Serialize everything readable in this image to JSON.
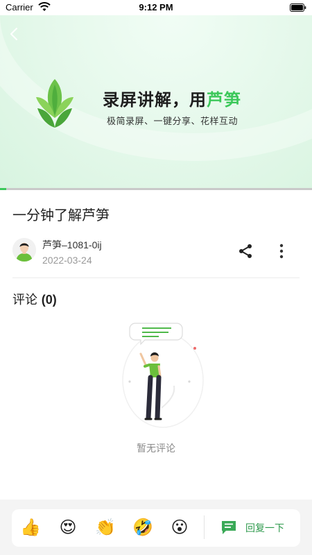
{
  "status_bar": {
    "carrier": "Carrier",
    "time": "9:12 PM"
  },
  "hero": {
    "title_main": "录屏讲解，用",
    "title_accent": "芦笋",
    "subtitle": "极简录屏、一键分享、花样互动",
    "progress_fraction": 0.02
  },
  "post": {
    "title": "一分钟了解芦笋",
    "author": "芦笋–1081-0ij",
    "date": "2022-03-24"
  },
  "comments": {
    "label": "评论",
    "count": "(0)",
    "empty_text": "暂无评论"
  },
  "reactions": [
    {
      "name": "thumbs-up",
      "glyph": "👍"
    },
    {
      "name": "heart-eyes",
      "glyph": "😍"
    },
    {
      "name": "clapping-hands",
      "glyph": "👏"
    },
    {
      "name": "rolling-laughing",
      "glyph": "🤣"
    },
    {
      "name": "surprised",
      "glyph": "😮"
    }
  ],
  "reply": {
    "label": "回复一下"
  },
  "colors": {
    "accent": "#3cc85a",
    "reply_text": "#2f9a4d"
  }
}
